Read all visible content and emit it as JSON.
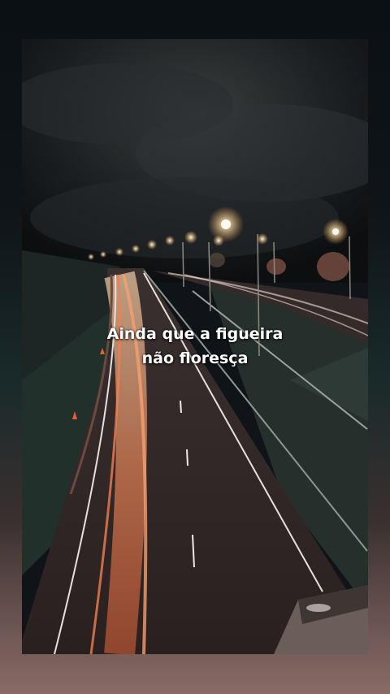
{
  "caption": {
    "line1": "Ainda que a figueira",
    "line2": "não floresça"
  },
  "colors": {
    "sky": "#1a1d1f",
    "road": "#2e2626",
    "light_trail": "#e06a3c",
    "lamp_glow": "#ffe9c0",
    "grass": "#24302d"
  }
}
